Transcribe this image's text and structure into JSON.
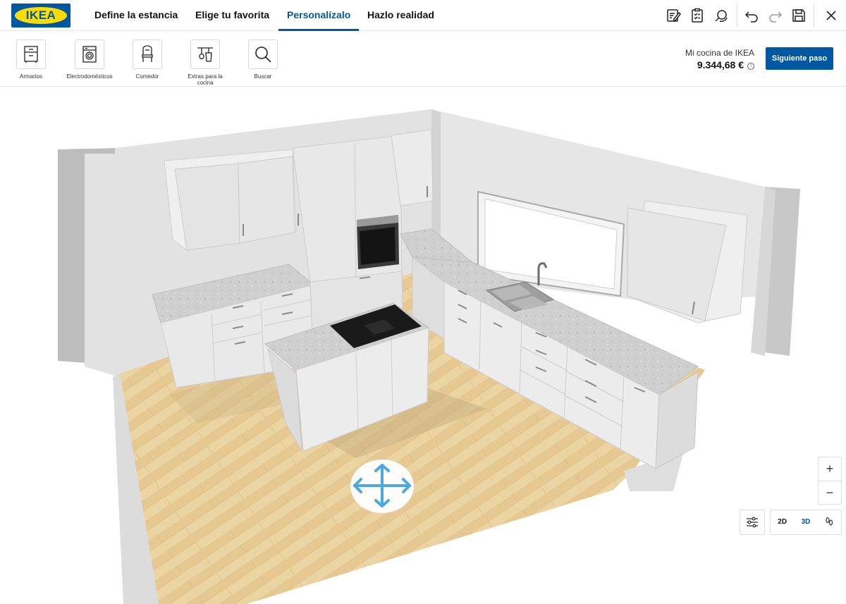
{
  "header": {
    "logo_text": "IKEA",
    "tabs": [
      {
        "label": "Define la estancia"
      },
      {
        "label": "Elige tu favorita"
      },
      {
        "label": "Personalízalo",
        "active": true
      },
      {
        "label": "Hazlo realidad"
      }
    ],
    "tools": [
      "edit-notes-icon",
      "checklist-icon",
      "search-3d-icon",
      "undo-icon",
      "redo-icon",
      "save-icon",
      "close-icon"
    ]
  },
  "categories": [
    {
      "label": "Armarios",
      "icon": "cabinet-icon"
    },
    {
      "label": "Electrodomésticos",
      "icon": "washing-machine-icon"
    },
    {
      "label": "Comedor",
      "icon": "chair-icon"
    },
    {
      "label": "Extras para la cocina",
      "icon": "kitchen-utensils-icon"
    },
    {
      "label": "Buscar",
      "icon": "search-icon"
    }
  ],
  "summary": {
    "kitchen_name": "Mi cocina de IKEA",
    "price": "9.344,68 €",
    "info_symbol": "i",
    "next_button": "Siguiente paso"
  },
  "view_controls": {
    "zoom_in": "+",
    "zoom_out": "−",
    "mode_2d": "2D",
    "mode_3d": "3D",
    "active_mode": "3D"
  },
  "colors": {
    "brand_blue": "#0058a3",
    "brand_yellow": "#ffdb00",
    "floor_wood": "#e8c98f",
    "move_handle": "#4aa9df"
  }
}
